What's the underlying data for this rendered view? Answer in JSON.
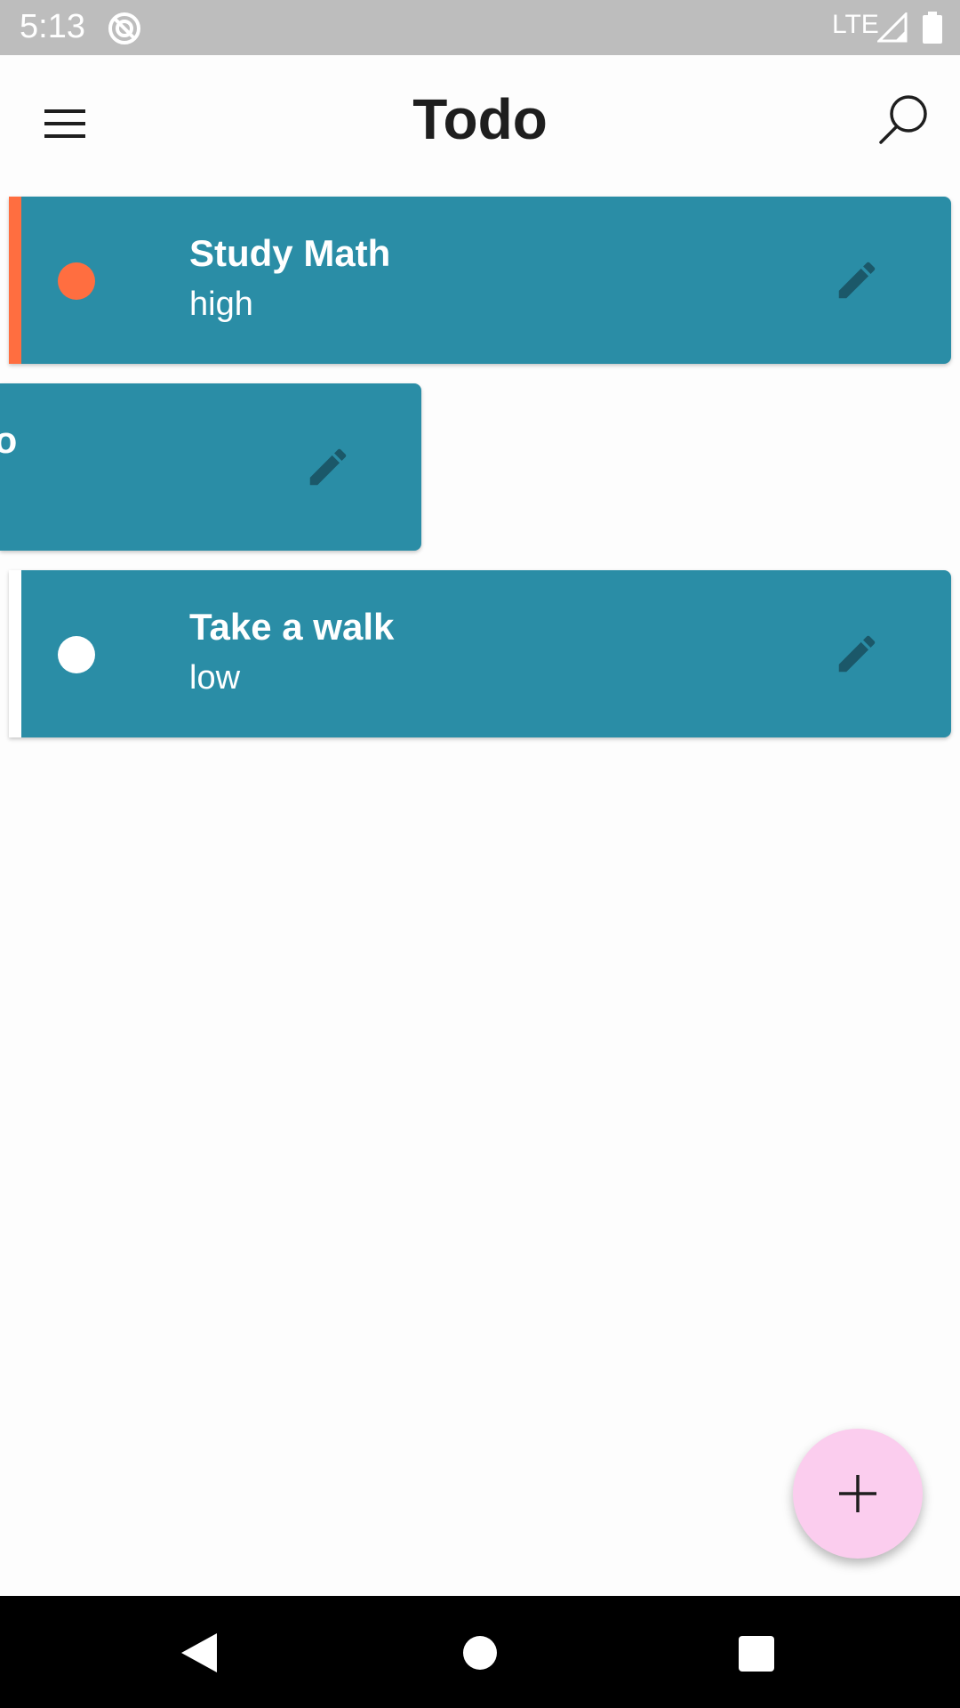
{
  "status_bar": {
    "time": "5:13",
    "network": "LTE",
    "icons": [
      "sync-icon",
      "signal-icon",
      "battery-icon"
    ]
  },
  "app_bar": {
    "title": "Todo",
    "menu_icon": "menu-icon",
    "search_icon": "search-icon"
  },
  "todos": [
    {
      "title": "Study Math",
      "priority": "high",
      "priority_color": "#ff6e40",
      "state": "normal"
    },
    {
      "title": "io",
      "priority": "",
      "priority_color": "#ffffff",
      "state": "swiped-left"
    },
    {
      "title": "Take a walk",
      "priority": "low",
      "priority_color": "#ffffff",
      "state": "normal"
    }
  ],
  "fab": {
    "icon": "plus-icon"
  },
  "colors": {
    "card": "#2a8da6",
    "edit_icon": "#1b5869",
    "fab": "#fbcdee",
    "high_priority": "#ff6e40",
    "low_priority": "#ffffff"
  },
  "nav_bar": {
    "icons": [
      "back-icon",
      "home-icon",
      "recents-icon"
    ]
  }
}
